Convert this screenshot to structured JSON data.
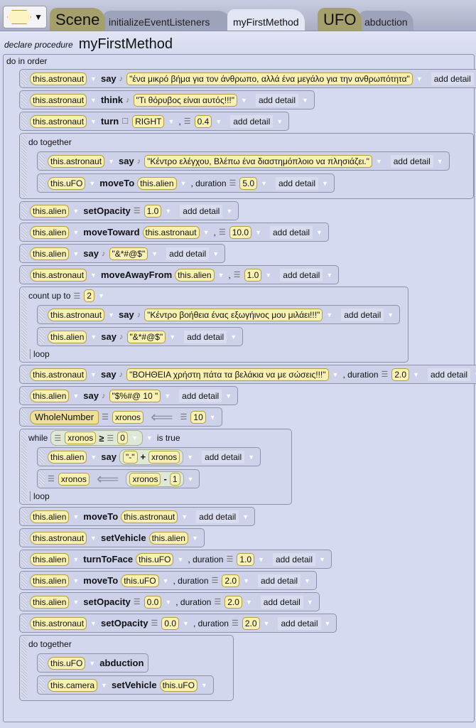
{
  "tabs": {
    "type_selector_icon": "hexagon-icon",
    "items": [
      {
        "label": "Scene",
        "kind": "type"
      },
      {
        "label": "initializeEventListeners",
        "kind": "method"
      },
      {
        "label": "myFirstMethod",
        "kind": "sel"
      },
      {
        "label": "UFO",
        "kind": "type"
      },
      {
        "label": "abduction",
        "kind": "method"
      }
    ]
  },
  "declaration": {
    "prefix": "declare procedure",
    "name": "myFirstMethod"
  },
  "do_in_order": "do in order",
  "statements": [
    {
      "t": [
        "o:this.astronaut",
        "k:say",
        "s:\"ένα μικρό βήμα για τον άνθρωπο, αλλά ένα μεγάλο για την ανθρωπότητα\"",
        "d:add detail"
      ]
    },
    {
      "t": [
        "o:this.astronaut",
        "k:think",
        "s:\"Τι θόρυβος είναι αυτός!!!\"",
        "d:add detail"
      ]
    },
    {
      "t": [
        "o:this.astronaut",
        "k:turn",
        "e:RIGHT",
        "p:,",
        "n:0.4",
        "d:add detail"
      ]
    },
    {
      "c": "do together",
      "body": [
        {
          "t": [
            "o:this.astronaut",
            "k:say",
            "s:\"Κέντρο ελέγχου, Βλέπω ένα διαστημόπλοιο να πλησιάζει.\"",
            "d:add detail"
          ]
        },
        {
          "t": [
            "o:this.uFO",
            "k:moveTo",
            "o:this.alien",
            "p:, duration",
            "n:5.0",
            "d:add detail"
          ]
        }
      ]
    },
    {
      "t": [
        "o:this.alien",
        "k:setOpacity",
        "n:1.0",
        "d:add detail"
      ]
    },
    {
      "t": [
        "o:this.alien",
        "k:moveToward",
        "o:this.astronaut",
        "p:,",
        "n:10.0",
        "d:add detail"
      ]
    },
    {
      "t": [
        "o:this.alien",
        "k:say",
        "s:\"&*#@$\"",
        "d:add detail"
      ]
    },
    {
      "t": [
        "o:this.astronaut",
        "k:moveAwayFrom",
        "o:this.alien",
        "p:,",
        "n:1.0",
        "d:add detail"
      ]
    },
    {
      "c": "count up to",
      "cval": "2",
      "loop": "loop",
      "body": [
        {
          "t": [
            "o:this.astronaut",
            "k:say",
            "s:\"Κέντρο βοήθεια ένας εξωγήινος μου μιλάει!!!\"",
            "d:add detail"
          ]
        },
        {
          "t": [
            "o:this.alien",
            "k:say",
            "s:\"&*#@$\"",
            "d:add detail"
          ]
        }
      ]
    },
    {
      "t": [
        "o:this.astronaut",
        "k:say",
        "s:\"ΒΟΗΘΕΙΑ χρήστη πάτα τα βελάκια να με σώσεις!!!\"",
        "p:, duration",
        "n:2.0",
        "d:add detail"
      ]
    },
    {
      "t": [
        "o:this.alien",
        "k:say",
        "s:\"$%#@ 10 \"",
        "d:add detail"
      ]
    },
    {
      "t": [
        "y:WholeNumber",
        "v:xronos",
        "a:⟸",
        "n:10"
      ]
    },
    {
      "c": "while",
      "cond": [
        "v:xronos",
        "k:≥",
        "n:0"
      ],
      "ctail": "is true",
      "loop": "loop",
      "body": [
        {
          "t": [
            "o:this.alien",
            "k:say",
            "x:\"-\"|+|xronos",
            "d:add detail"
          ]
        },
        {
          "t": [
            "v:xronos",
            "a:⟸",
            "x:xronos|-|1"
          ]
        }
      ]
    },
    {
      "t": [
        "o:this.alien",
        "k:moveTo",
        "o:this.astronaut",
        "d:add detail"
      ]
    },
    {
      "t": [
        "o:this.astronaut",
        "k:setVehicle",
        "o:this.alien"
      ]
    },
    {
      "t": [
        "o:this.alien",
        "k:turnToFace",
        "o:this.uFO",
        "p:, duration",
        "n:1.0",
        "d:add detail"
      ]
    },
    {
      "t": [
        "o:this.alien",
        "k:moveTo",
        "o:this.uFO",
        "p:, duration",
        "n:2.0",
        "d:add detail"
      ]
    },
    {
      "t": [
        "o:this.alien",
        "k:setOpacity",
        "n:0.0",
        "p:, duration",
        "n:2.0",
        "d:add detail"
      ]
    },
    {
      "t": [
        "o:this.astronaut",
        "k:setOpacity",
        "n:0.0",
        "p:, duration",
        "n:2.0",
        "d:add detail"
      ]
    },
    {
      "c": "do together",
      "body": [
        {
          "t": [
            "o:this.uFO",
            "k:abduction"
          ]
        },
        {
          "t": [
            "o:this.camera",
            "k:setVehicle",
            "o:this.uFO"
          ]
        }
      ]
    }
  ]
}
